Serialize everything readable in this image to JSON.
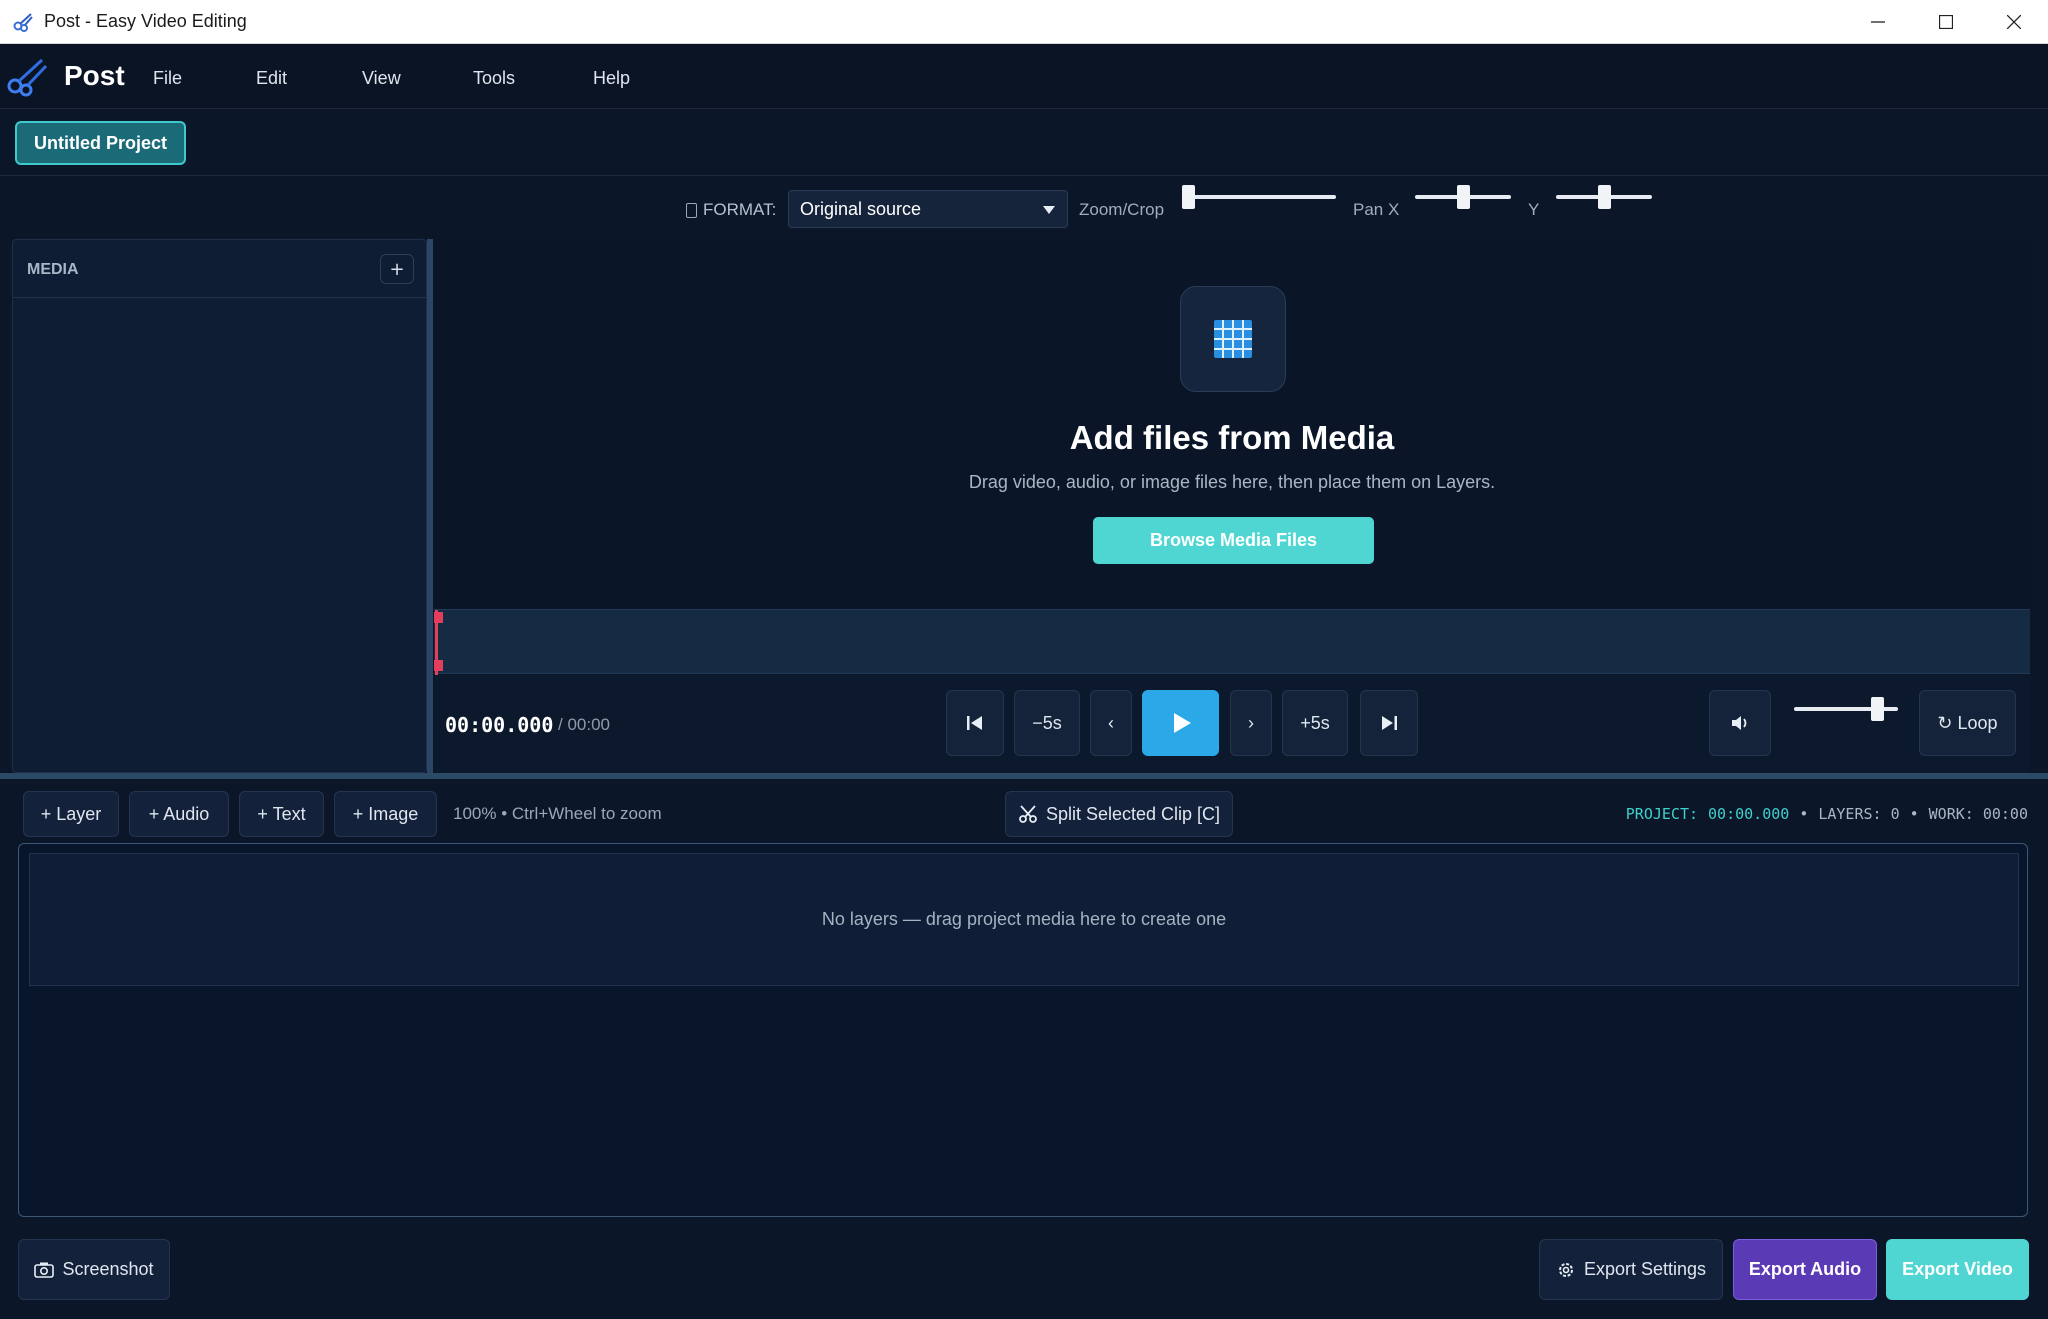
{
  "window": {
    "title": "Post - Easy Video Editing"
  },
  "menubar": {
    "brand": "Post",
    "items": [
      "File",
      "Edit",
      "View",
      "Tools",
      "Help"
    ]
  },
  "project": {
    "name": "Untitled Project"
  },
  "format_bar": {
    "format_label": "FORMAT:",
    "format_value": "Original source",
    "zoom_label": "Zoom/Crop",
    "zoom_level": 0.0,
    "pan_x_label": "Pan X",
    "pan_x_level": 0.5,
    "y_label": "Y",
    "y_level": 0.5
  },
  "media_panel": {
    "title": "MEDIA",
    "add_label": "+"
  },
  "preview": {
    "title": "Add files from Media",
    "subtitle": "Drag video, audio, or image files here, then place them on Layers.",
    "browse_label": "Browse Media Files"
  },
  "transport": {
    "current_time": "00:00.000",
    "total_time": "/ 00:00",
    "back5_label": "−5s",
    "prev_frame_label": "‹",
    "next_frame_label": "›",
    "fwd5_label": "+5s",
    "volume_level": 0.8,
    "loop_label": "↻ Loop"
  },
  "layers_toolbar": {
    "add_layer": "+ Layer",
    "add_audio": "+ Audio",
    "add_text": "+ Text",
    "add_image": "+ Image",
    "zoom_hint": "100% • Ctrl+Wheel to zoom",
    "split_label": "Split Selected Clip [C]",
    "status": {
      "project_label": "PROJECT:",
      "project_time": "00:00.000",
      "sep": "•",
      "layers": "LAYERS: 0",
      "work": "WORK: 00:00"
    }
  },
  "layers_area": {
    "empty_text": "No layers — drag project media here to create one"
  },
  "footer": {
    "screenshot_label": "Screenshot",
    "export_settings_label": "Export Settings",
    "export_audio_label": "Export Audio",
    "export_video_label": "Export Video"
  },
  "colors": {
    "accent_teal": "#4fd6d2",
    "accent_blue": "#2aa8e8",
    "accent_purple": "#5a3bb5",
    "playhead": "#e33e5c",
    "background": "#0b1628"
  },
  "icons": {
    "app": "scissors-film-icon",
    "preview": "grid-icon",
    "split": "scissors-icon",
    "volume": "speaker-icon",
    "screenshot": "camera-icon",
    "settings": "gear-icon"
  }
}
